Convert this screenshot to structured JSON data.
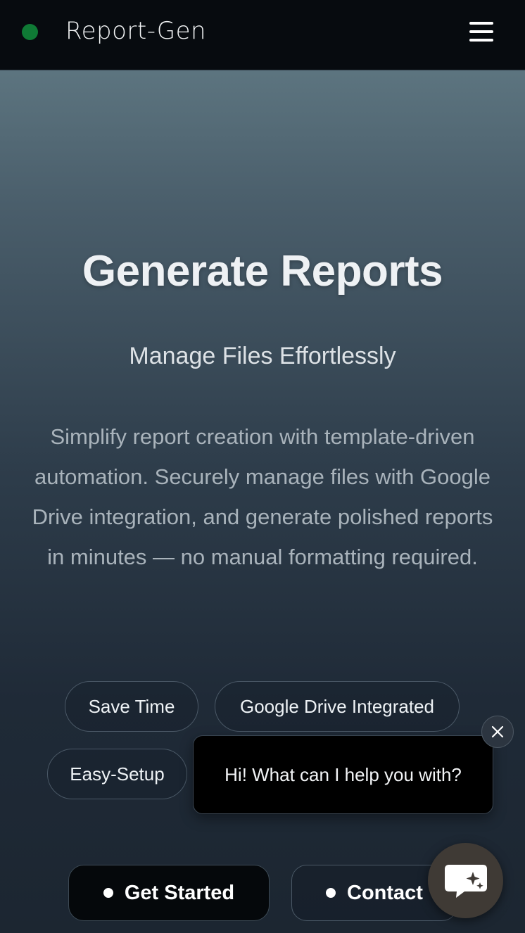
{
  "header": {
    "brand": "Report-Gen",
    "status_color": "#0f7a35",
    "menu_icon": "hamburger-menu-icon"
  },
  "hero": {
    "title": "Generate Reports",
    "subtitle": "Manage Files Effortlessly",
    "description": "Simplify report creation with template-driven automation. Securely manage files with Google Drive integration, and generate polished reports in minutes — no manual formatting required."
  },
  "features": [
    {
      "label": "Save Time"
    },
    {
      "label": "Google Drive Integrated"
    },
    {
      "label": "Easy-Setup"
    }
  ],
  "chat": {
    "message": "Hi! What can I help you with?",
    "close_icon": "close-icon",
    "launcher_icon": "chat-sparkle-icon"
  },
  "actions": {
    "get_started_label": "Get Started",
    "contact_label": "Contact"
  }
}
